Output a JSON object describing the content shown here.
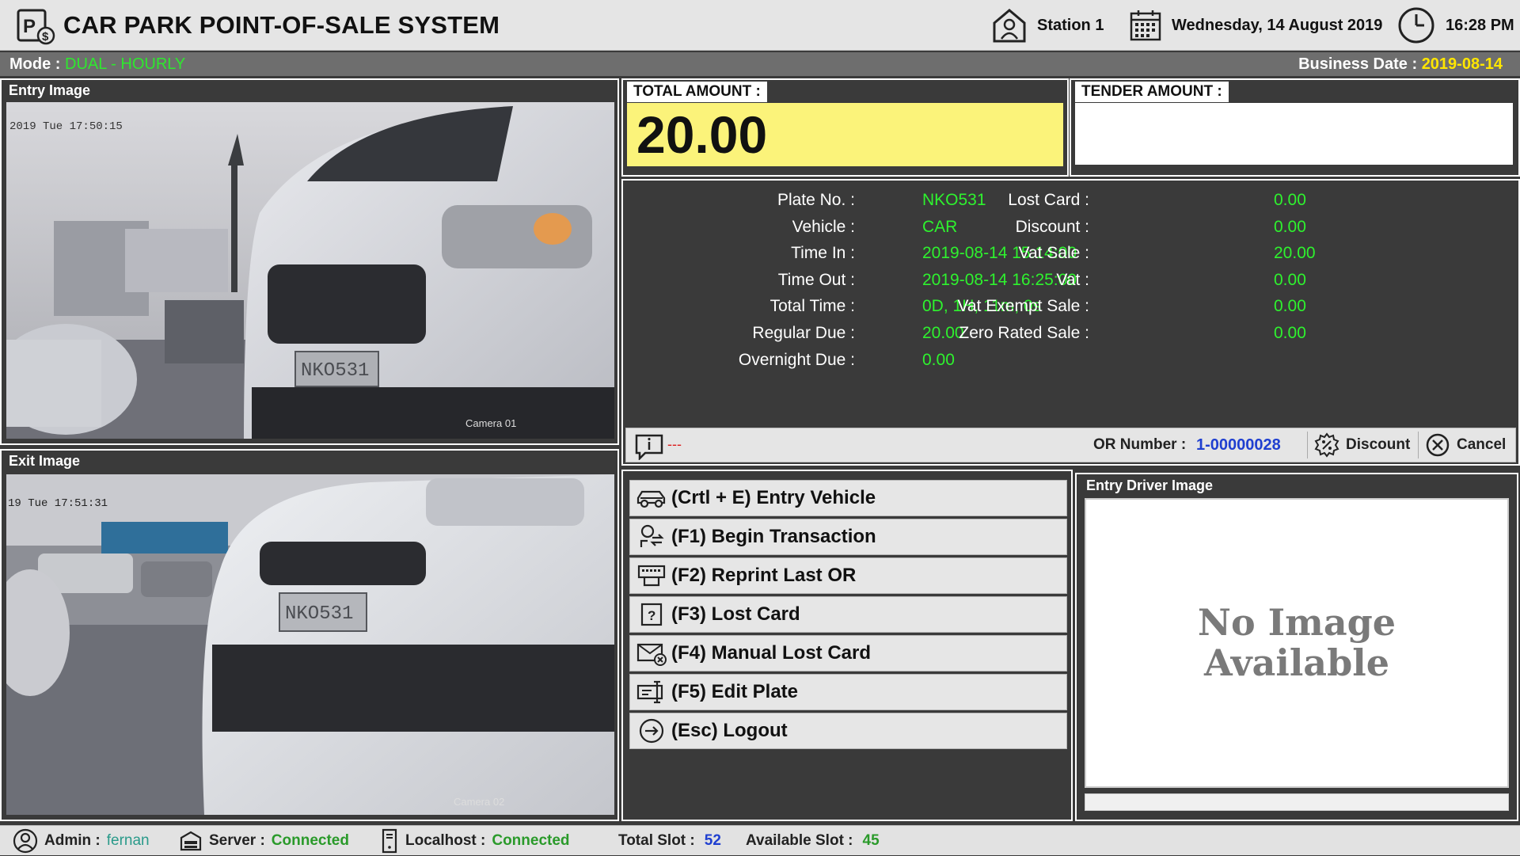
{
  "header": {
    "app_title": "CAR PARK POINT-OF-SALE SYSTEM",
    "station": "Station 1",
    "date": "Wednesday, 14 August 2019",
    "time": "16:28 PM"
  },
  "modebar": {
    "mode_label": "Mode :",
    "mode_value": "DUAL - HOURLY",
    "business_date_label": "Business Date :",
    "business_date_value": "2019-08-14"
  },
  "entry_image": {
    "title": "Entry Image",
    "timestamp": "2019 Tue 17:50:15",
    "camera_label": "Camera 01",
    "plate": "NKO531"
  },
  "exit_image": {
    "title": "Exit Image",
    "timestamp": "19 Tue 17:51:31",
    "camera_label": "Camera 02",
    "plate": "NKO531"
  },
  "amounts": {
    "total_label": "TOTAL AMOUNT :",
    "total_value": "20.00",
    "tender_label": "TENDER AMOUNT :",
    "tender_value": ""
  },
  "details_left": [
    {
      "label": "Plate No. :",
      "value": "NKO531"
    },
    {
      "label": "Vehicle :",
      "value": "CAR"
    },
    {
      "label": "Time In :",
      "value": "2019-08-14 15:14:00"
    },
    {
      "label": "Time Out :",
      "value": "2019-08-14 16:25:00"
    },
    {
      "label": "Total Time :",
      "value": "0D, 1H, 11m, 0s"
    },
    {
      "label": "Regular Due :",
      "value": "20.00"
    },
    {
      "label": "Overnight Due :",
      "value": "0.00"
    }
  ],
  "details_right": [
    {
      "label": "Lost Card :",
      "value": "0.00"
    },
    {
      "label": "Discount :",
      "value": "0.00"
    },
    {
      "label": "Vat Sale :",
      "value": "20.00"
    },
    {
      "label": "Vat :",
      "value": "0.00"
    },
    {
      "label": "Vat Exempt Sale :",
      "value": "0.00"
    },
    {
      "label": "Zero Rated Sale :",
      "value": "0.00"
    }
  ],
  "infobar": {
    "message": "---",
    "or_label": "OR Number :",
    "or_value": "1-00000028",
    "discount_label": "Discount",
    "cancel_label": "Cancel"
  },
  "functions": [
    {
      "label": "(Crtl + E) Entry Vehicle",
      "icon": "car-icon"
    },
    {
      "label": "(F1) Begin Transaction",
      "icon": "transaction-icon"
    },
    {
      "label": "(F2) Reprint Last OR",
      "icon": "printer-icon"
    },
    {
      "label": "(F3) Lost Card",
      "icon": "lost-card-icon"
    },
    {
      "label": "(F4) Manual Lost Card",
      "icon": "manual-lost-card-icon"
    },
    {
      "label": "(F5) Edit Plate",
      "icon": "edit-plate-icon"
    },
    {
      "label": "(Esc) Logout",
      "icon": "logout-icon"
    }
  ],
  "driver_image": {
    "title": "Entry Driver Image",
    "placeholder_line1": "No Image",
    "placeholder_line2": "Available"
  },
  "footer": {
    "admin_label": "Admin :",
    "admin_value": "fernan",
    "server_label": "Server :",
    "server_value": "Connected",
    "localhost_label": "Localhost :",
    "localhost_value": "Connected",
    "total_slot_label": "Total Slot :",
    "total_slot_value": "52",
    "available_slot_label": "Available Slot :",
    "available_slot_value": "45"
  },
  "colors": {
    "total_amount_bg": "#fbf37a",
    "value_green": "#2ef22e",
    "accent_blue": "#1f3fd0"
  }
}
